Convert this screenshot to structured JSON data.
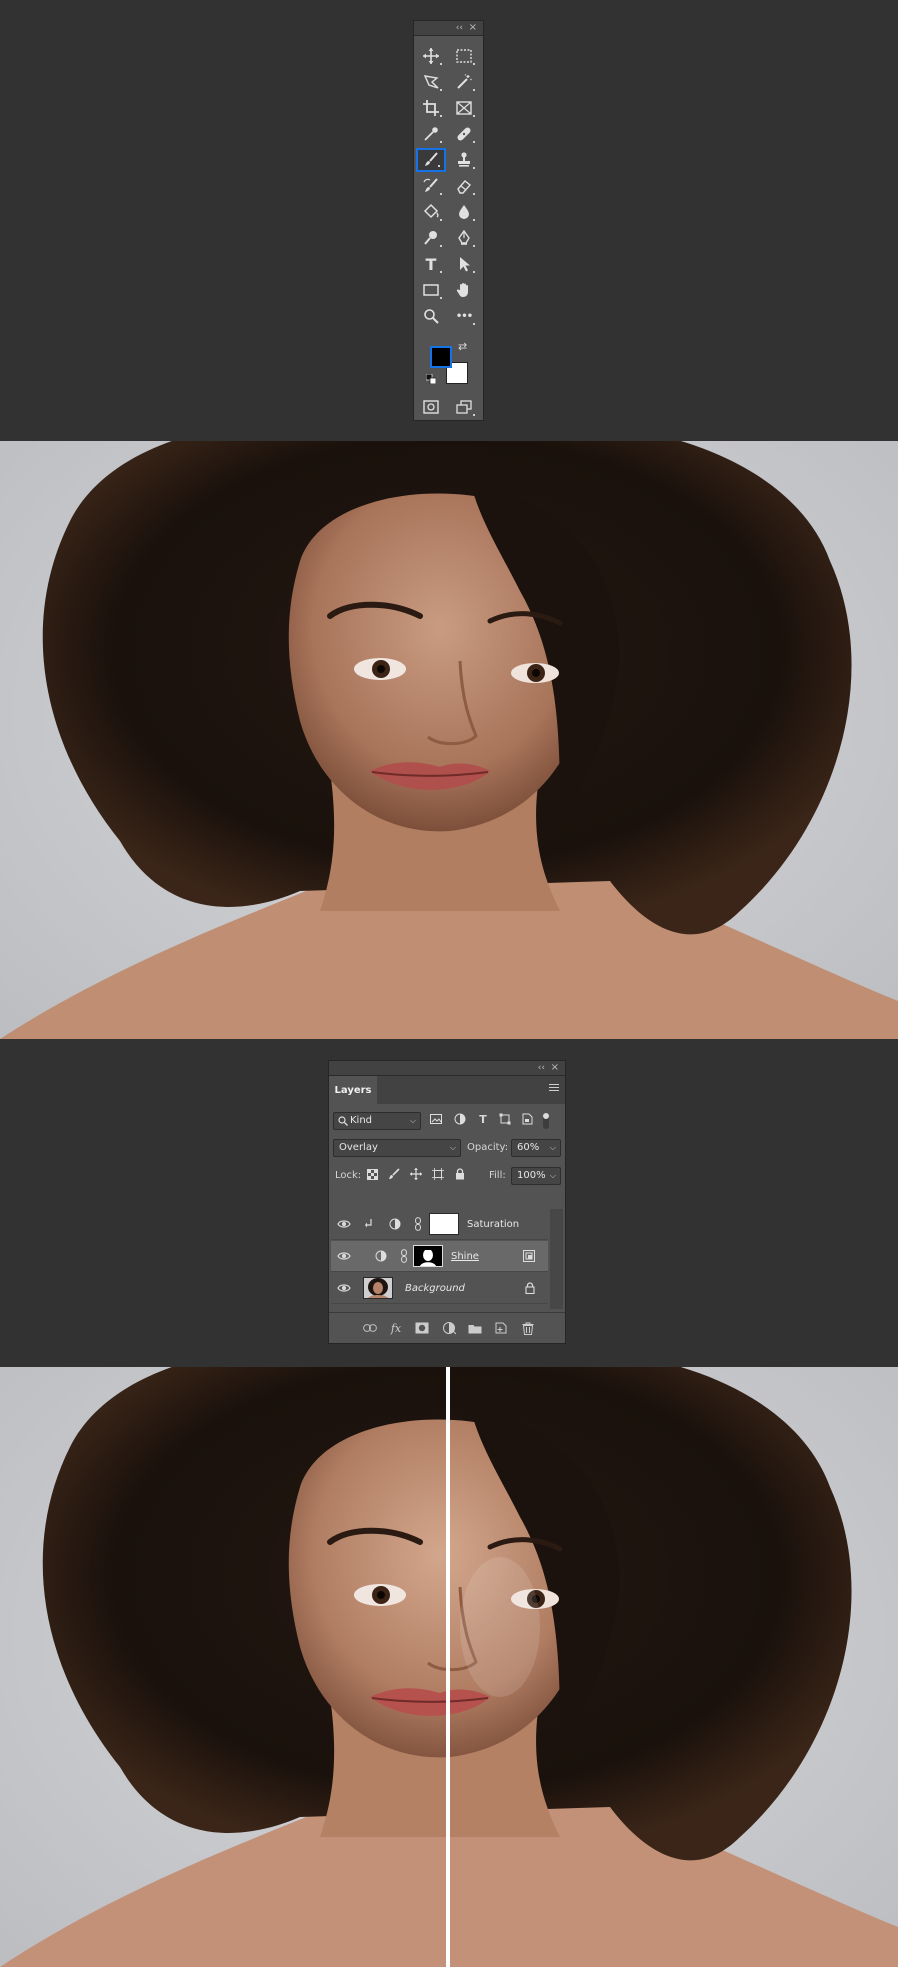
{
  "toolbar": {
    "collapse_glyph": "‹‹",
    "close_glyph": "×",
    "type_tool_glyph": "T",
    "more_glyph": "•••",
    "swap_glyph": "⇄"
  },
  "layers_panel": {
    "collapse_glyph": "‹‹",
    "close_glyph": "×",
    "tab_label": "Layers",
    "filter_value": "Kind",
    "blend_mode": "Overlay",
    "opacity_label": "Opacity:",
    "opacity_value": "60%",
    "lock_label": "Lock:",
    "fill_label": "Fill:",
    "fill_value": "100%",
    "type_filter_glyph": "T",
    "layers": [
      {
        "name": "Saturation"
      },
      {
        "name": "Shine"
      },
      {
        "name": "Background"
      }
    ],
    "fx_label": "fx"
  },
  "colors": {
    "accent": "#1473e6",
    "foreground": "#000000",
    "background": "#ffffff"
  }
}
